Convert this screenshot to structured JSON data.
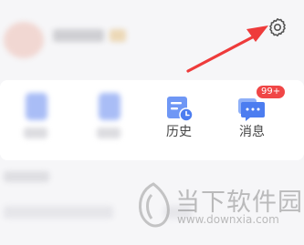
{
  "menu": {
    "items": [
      {
        "label": "历史",
        "icon": "history-icon"
      },
      {
        "label": "消息",
        "icon": "message-icon",
        "badge": "99+"
      }
    ]
  },
  "header": {
    "icon": "gear-icon"
  },
  "watermark": {
    "name": "当下软件园",
    "url": "www.downxia.com"
  },
  "colors": {
    "accent": "#4c7df0",
    "badge": "#f04646",
    "arrow": "#ee3b3b"
  }
}
